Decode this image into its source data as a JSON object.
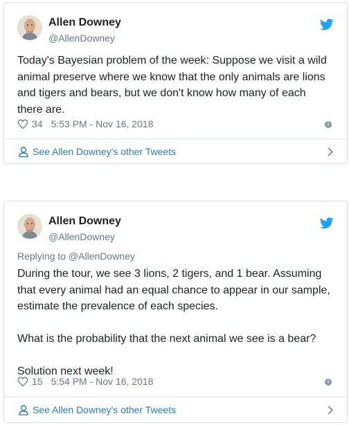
{
  "tweets": [
    {
      "author_name": "Allen Downey",
      "author_handle": "@AllenDowney",
      "replying_to": "",
      "text": "Today's Bayesian problem of the week: Suppose we visit a wild animal preserve where we know that the only animals are lions and tigers and bears, but we don't know how many of each there are.",
      "likes": "34",
      "timestamp": "5:53 PM - Nov 16, 2018",
      "footer_link": "See Allen Downey's other Tweets"
    },
    {
      "author_name": "Allen Downey",
      "author_handle": "@AllenDowney",
      "replying_to": "Replying to @AllenDowney",
      "text": "During the tour, we see 3 lions, 2 tigers, and 1 bear. Assuming that every animal had an equal chance to appear in our sample, estimate the prevalence of each species.\n\nWhat is the probability that the next animal we see is a bear?\n\nSolution next week!",
      "likes": "15",
      "timestamp": "5:54 PM - Nov 16, 2018",
      "footer_link": "See Allen Downey's other Tweets"
    }
  ],
  "icons": {
    "brand": "twitter-bird-icon",
    "like": "heart-icon",
    "info": "info-icon",
    "profile": "person-icon",
    "chevron": "chevron-right-icon"
  },
  "colors": {
    "twitter_blue": "#1da1f2",
    "link": "#2b7bb9",
    "secondary_text": "#697882",
    "border": "#d8dee2"
  }
}
